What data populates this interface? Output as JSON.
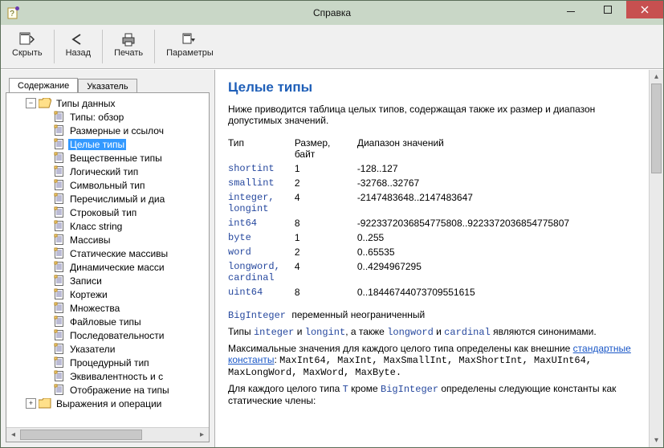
{
  "window": {
    "title": "Справка"
  },
  "toolbar": {
    "hide": "Скрыть",
    "back": "Назад",
    "print": "Печать",
    "options": "Параметры"
  },
  "tabs": {
    "contents": "Содержание",
    "index": "Указатель"
  },
  "tree": {
    "root": "Типы данных",
    "items": [
      "Типы: обзор",
      "Размерные и ссылоч",
      "Целые типы",
      "Вещественные типы",
      "Логический тип",
      "Символьный тип",
      "Перечислимый и диа",
      "Строковый тип",
      "Класс string",
      "Массивы",
      "Статические массивы",
      "Динамические масси",
      "Записи",
      "Кортежи",
      "Множества",
      "Файловые типы",
      "Последовательности",
      "Указатели",
      "Процедурный тип",
      "Эквивалентность и с",
      "Отображение на типы"
    ],
    "selectedIndex": 2,
    "root2": "Выражения и операции"
  },
  "doc": {
    "title": "Целые типы",
    "intro": "Ниже приводится таблица целых типов, содержащая также их размер и диапазон допустимых значений.",
    "th_type": "Тип",
    "th_size": "Размер, байт",
    "th_range": "Диапазон значений",
    "rows": [
      {
        "type": "shortint",
        "size": "1",
        "range": "-128..127"
      },
      {
        "type": "smallint",
        "size": "2",
        "range": "-32768..32767"
      },
      {
        "type": "integer, longint",
        "size": "4",
        "range": "-2147483648..2147483647"
      },
      {
        "type": "int64",
        "size": "8",
        "range": "-9223372036854775808..9223372036854775807"
      },
      {
        "type": "byte",
        "size": "1",
        "range": "0..255"
      },
      {
        "type": "word",
        "size": "2",
        "range": "0..65535"
      },
      {
        "type": "longword, cardinal",
        "size": "4",
        "range": "0..4294967295"
      },
      {
        "type": "uint64",
        "size": "8",
        "range": "0..18446744073709551615"
      }
    ],
    "bigint_type": "BigInteger",
    "bigint_note": "переменный неограниченный",
    "synonyms_1": "Типы ",
    "synonyms_t1": "integer",
    "synonyms_and1": " и ",
    "synonyms_t2": "longint",
    "synonyms_mid": ", а также ",
    "synonyms_t3": "longword",
    "synonyms_and2": " и ",
    "synonyms_t4": "cardinal",
    "synonyms_end": " являются синонимами.",
    "max_intro": "Максимальные значения для каждого целого типа определены как внешние ",
    "max_link": "стандартные константы",
    "max_after": ": ",
    "max_consts": "MaxInt64, MaxInt, MaxSmallInt, MaxShortInt, MaxUInt64, MaxLongWord, MaxWord, MaxByte.",
    "per_type_1": "Для каждого целого типа ",
    "per_type_T": "T",
    "per_type_2": " кроме ",
    "per_type_big": "BigInteger",
    "per_type_3": " определены следующие константы как статические члены:"
  }
}
